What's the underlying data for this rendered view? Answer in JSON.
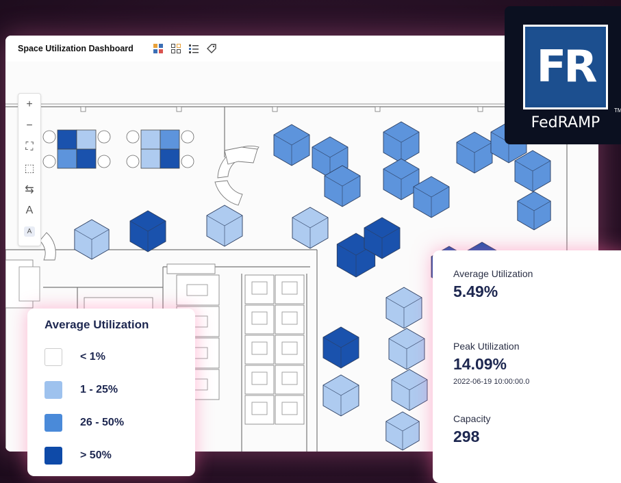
{
  "window": {
    "title": "Space Utilization Dashboard",
    "view_icons": [
      "grid-color-icon",
      "grid-outline-icon",
      "list-icon",
      "tag-icon"
    ]
  },
  "toolbar": {
    "tools": [
      {
        "name": "zoom-in",
        "glyph": "+"
      },
      {
        "name": "zoom-out",
        "glyph": "−"
      },
      {
        "name": "fit-screen",
        "glyph": "⛶"
      },
      {
        "name": "select-area",
        "glyph": "⬚"
      },
      {
        "name": "route",
        "glyph": "⇆"
      },
      {
        "name": "text-large",
        "glyph": "A"
      },
      {
        "name": "text-small",
        "glyph": "A"
      }
    ]
  },
  "legend": {
    "title": "Average Utilization",
    "items": [
      {
        "label": "< 1%",
        "color": "#ffffff"
      },
      {
        "label": "1 - 25%",
        "color": "#9ec2ee"
      },
      {
        "label": "26 - 50%",
        "color": "#4a8ad9"
      },
      {
        "label": "> 50%",
        "color": "#0e4aa8"
      }
    ]
  },
  "stats": {
    "avg_label": "Average Utilization",
    "avg_value": "5.49%",
    "peak_label": "Peak Utilization",
    "peak_value": "14.09%",
    "peak_time": "2022-06-19 10:00:00.0",
    "capacity_label": "Capacity",
    "capacity_value": "298"
  },
  "badge": {
    "letters": "FR",
    "name": "FedRAMP",
    "tm": "TM"
  },
  "colors": {
    "light": "#aecbf0",
    "medium": "#5d94dc",
    "dark": "#1a52ad"
  }
}
